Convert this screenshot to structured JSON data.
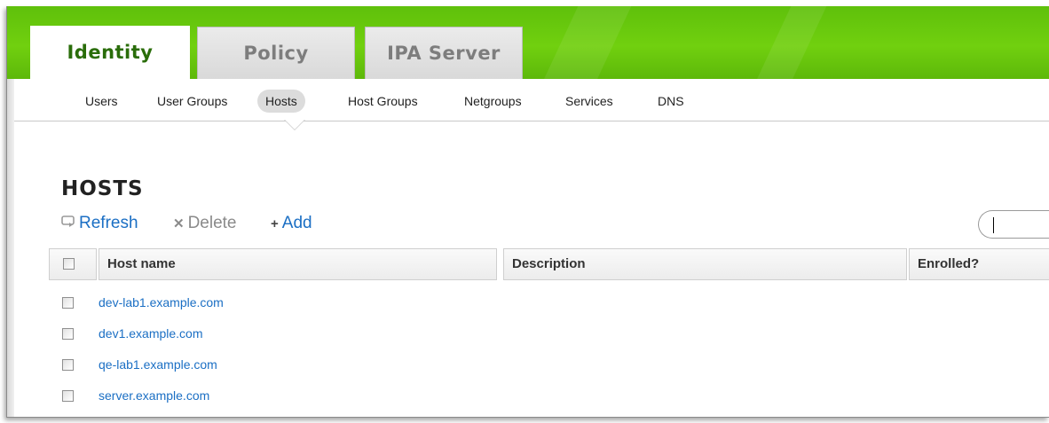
{
  "tabs": [
    {
      "label": "Identity",
      "active": true
    },
    {
      "label": "Policy",
      "active": false
    },
    {
      "label": "IPA Server",
      "active": false
    }
  ],
  "subnav": [
    {
      "label": "Users",
      "active": false
    },
    {
      "label": "User Groups",
      "active": false
    },
    {
      "label": "Hosts",
      "active": true
    },
    {
      "label": "Host Groups",
      "active": false
    },
    {
      "label": "Netgroups",
      "active": false
    },
    {
      "label": "Services",
      "active": false
    },
    {
      "label": "DNS",
      "active": false
    }
  ],
  "page": {
    "title": "HOSTS"
  },
  "actions": {
    "refresh": {
      "label": "Refresh",
      "icon": "refresh-icon"
    },
    "delete": {
      "label": "Delete",
      "icon": "x-icon"
    },
    "add": {
      "label": "Add",
      "icon": "plus-icon"
    }
  },
  "search": {
    "value": ""
  },
  "table": {
    "columns": [
      "Host name",
      "Description",
      "Enrolled?"
    ],
    "rows": [
      {
        "host": "dev-lab1.example.com",
        "description": "",
        "enrolled": ""
      },
      {
        "host": "dev1.example.com",
        "description": "",
        "enrolled": ""
      },
      {
        "host": "qe-lab1.example.com",
        "description": "",
        "enrolled": ""
      },
      {
        "host": "server.example.com",
        "description": "",
        "enrolled": ""
      }
    ]
  },
  "colors": {
    "header_green": "#6ccb0e",
    "link_blue": "#1b6fc4",
    "active_tab_text": "#2a6d0a"
  }
}
